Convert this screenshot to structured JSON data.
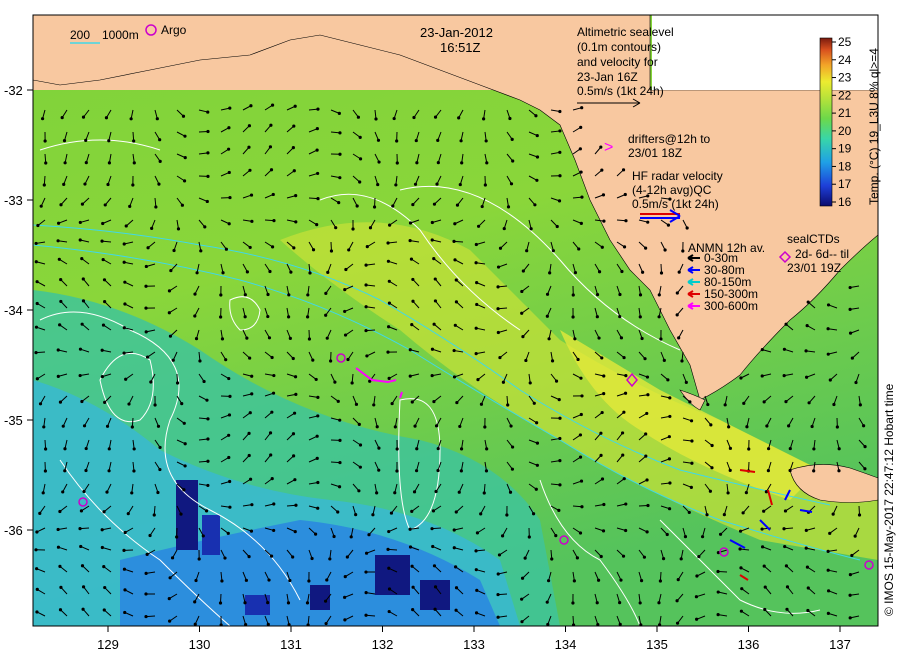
{
  "map": {
    "date": "23-Jan-2012",
    "time": "16:51Z",
    "lon_ticks": [
      "129",
      "130",
      "131",
      "132",
      "133",
      "134",
      "135",
      "136",
      "137"
    ],
    "lat_ticks": [
      "-32",
      "-33",
      "-34",
      "-35",
      "-36"
    ],
    "bathy_legend": {
      "a": "200",
      "b": "1000m"
    },
    "argo_label": "Argo",
    "altimetry": {
      "lines": [
        "Altimetric sealevel",
        "(0.1m contours)",
        "and velocity for",
        "23-Jan 16Z",
        "0.5m/s (1kt 24h)"
      ]
    },
    "drifters": {
      "lines": [
        "drifters@12h to",
        "23/01 18Z"
      ]
    },
    "hf_radar": {
      "lines": [
        "HF radar velocity",
        "(4-12h avg)QC",
        "0.5m/s (1kt 24h)"
      ]
    },
    "anmn": {
      "title": "ANMN 12h av.",
      "items": [
        {
          "label": "0-30m",
          "color": "#000000"
        },
        {
          "label": "30-80m",
          "color": "#0000ff"
        },
        {
          "label": "80-150m",
          "color": "#00cccc"
        },
        {
          "label": "150-300m",
          "color": "#dd0000"
        },
        {
          "label": "300-600m",
          "color": "#ff00ff"
        }
      ]
    },
    "seal": {
      "lines": [
        "sealCTDs",
        "2d- 6d-- til",
        "23/01 19Z"
      ]
    },
    "colorbar": {
      "title": "Temp. (°C) 19_L3U 8% ql>=4",
      "ticks": [
        "16",
        "17",
        "18",
        "19",
        "20",
        "21",
        "22",
        "23",
        "24",
        "25"
      ]
    },
    "credit": "© IMOS 15-May-2017 22:47:12 Hobart time"
  }
}
